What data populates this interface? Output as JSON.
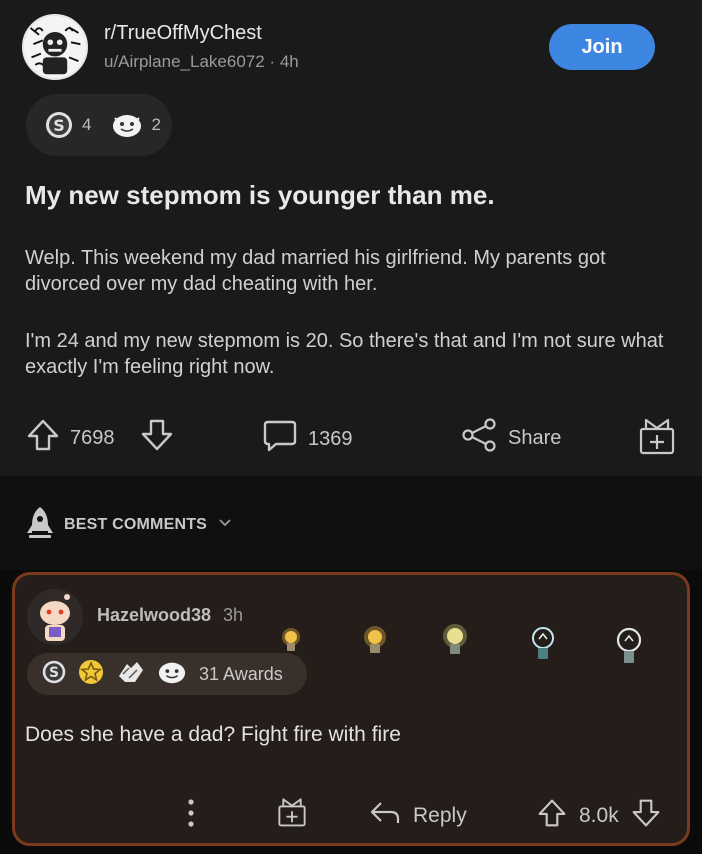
{
  "post": {
    "subreddit": "r/TrueOffMyChest",
    "author": "u/Airplane_Lake6072",
    "age": "4h",
    "join_label": "Join",
    "awards": [
      {
        "icon": "silver-award-icon",
        "count": "4"
      },
      {
        "icon": "wholesome-award-icon",
        "count": "2"
      }
    ],
    "title": "My new stepmom is younger than me.",
    "paragraphs": [
      "Welp. This weekend my dad married his girlfriend. My parents got divorced over my dad cheating with her.",
      "I'm 24 and my new stepmom is 20. So there's that and I'm not sure what exactly I'm feeling right now."
    ],
    "votes": "7698",
    "comments": "1369",
    "share_label": "Share"
  },
  "sort": {
    "label": "BEST COMMENTS"
  },
  "comment": {
    "user": "Hazelwood38",
    "age": "3h",
    "awards_label": "31 Awards",
    "text": "Does she have a dad?  Fight fire with fire",
    "reply_label": "Reply",
    "votes": "8.0k"
  },
  "colors": {
    "accent": "#3d87e3",
    "post_bg": "#1a1a1b",
    "comment_border": "#7a3a1e",
    "comment_bg": "#241d19"
  }
}
